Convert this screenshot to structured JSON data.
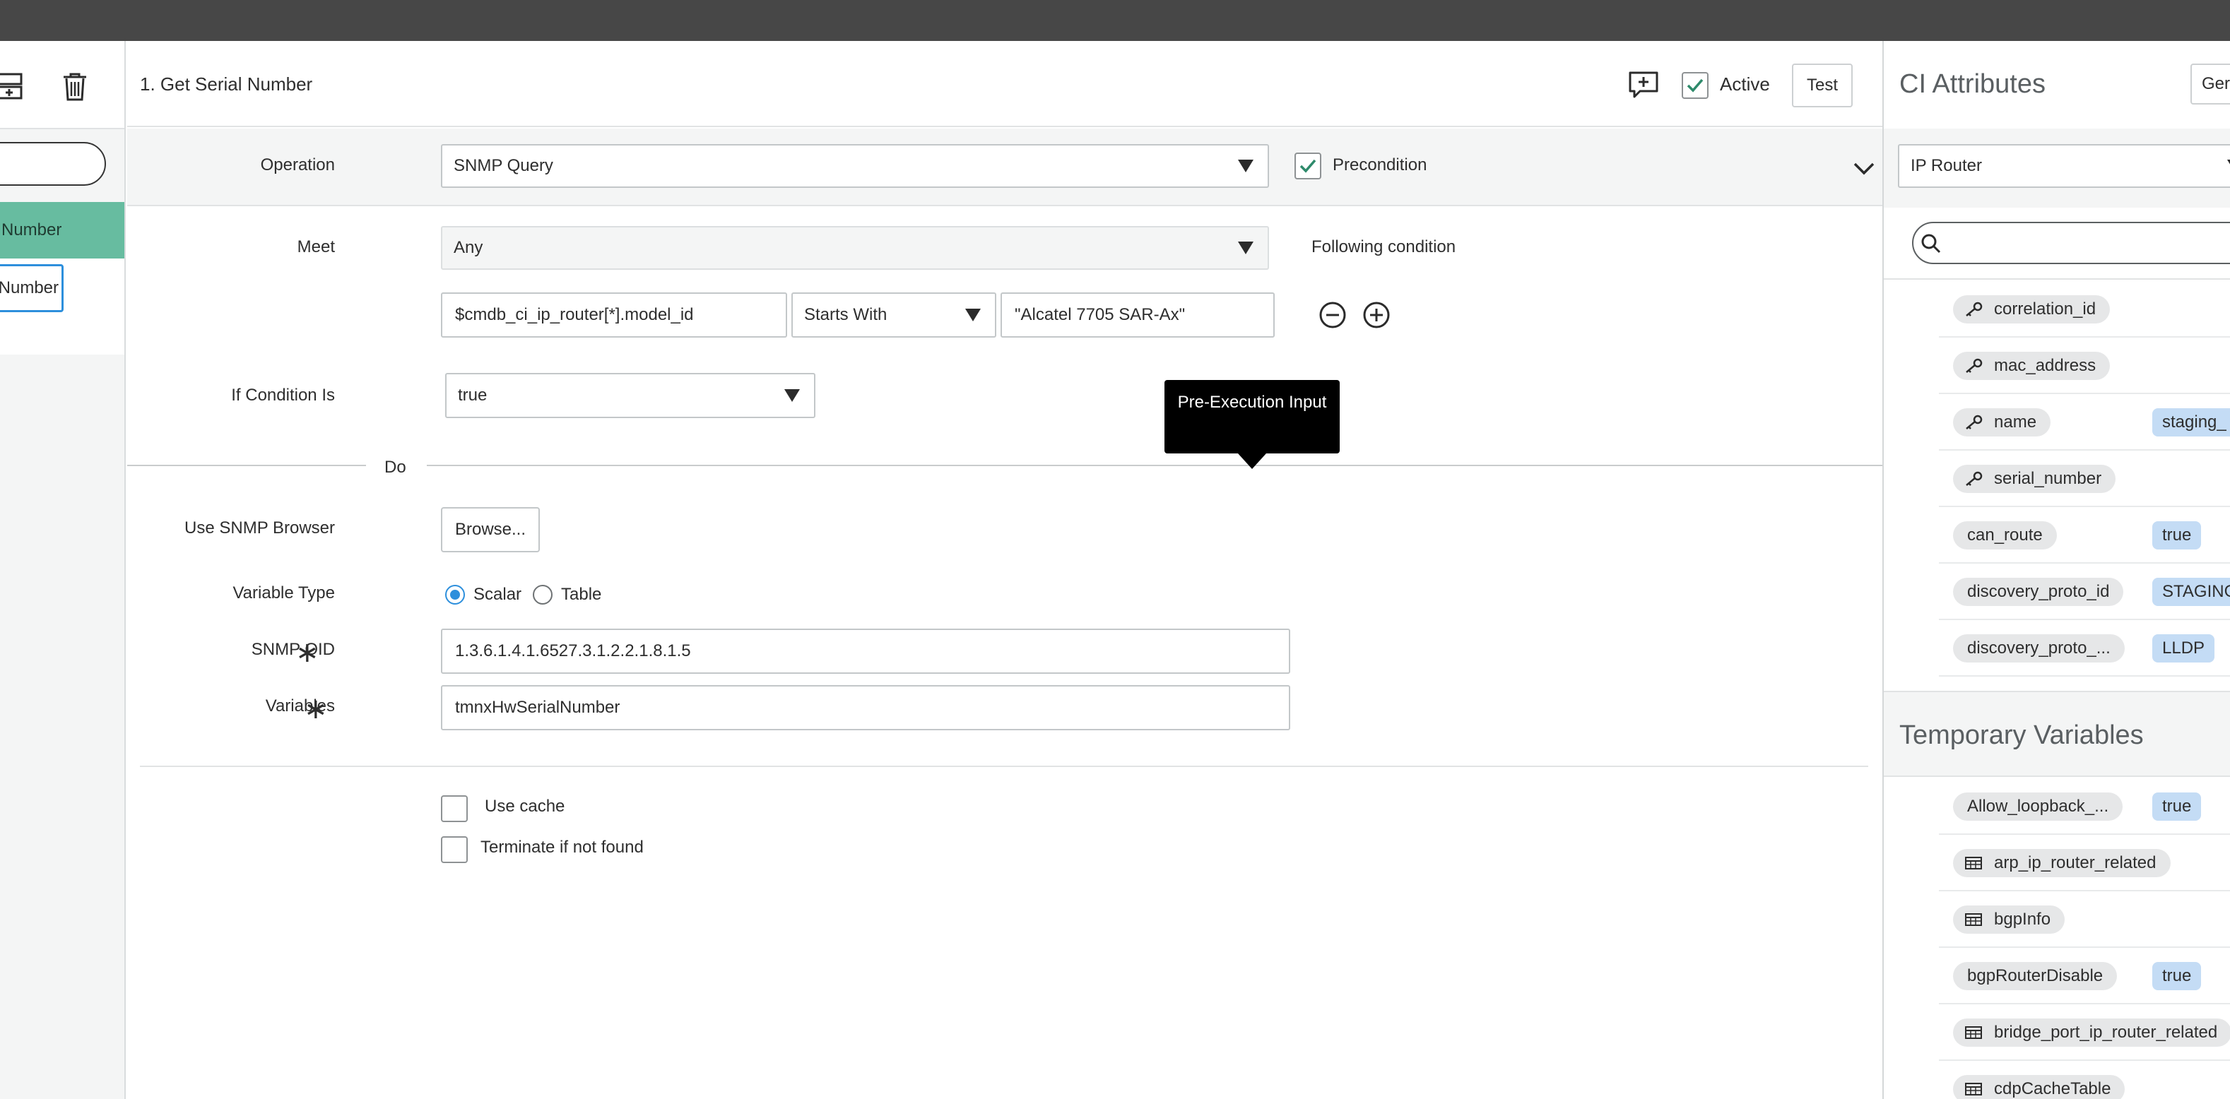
{
  "left_panel": {
    "selected_step": "Number",
    "editing_step": "Number"
  },
  "header": {
    "step_title": "1. Get Serial Number",
    "active_label": "Active",
    "active_checked": true,
    "test_label": "Test"
  },
  "operation": {
    "label": "Operation",
    "value": "SNMP Query",
    "precondition_label": "Precondition",
    "precondition_checked": true
  },
  "condition": {
    "meet_label": "Meet",
    "meet_value": "Any",
    "following_label": "Following condition",
    "field_value": "$cmdb_ci_ip_router[*].model_id",
    "operator_value": "Starts With",
    "match_value": "\"Alcatel 7705 SAR-Ax\"",
    "if_condition_label": "If Condition Is",
    "if_condition_value": "true"
  },
  "do_label": "Do",
  "tooltip": "Pre-Execution Input",
  "snmp": {
    "browser_label": "Use SNMP Browser",
    "browse_button": "Browse...",
    "variable_type_label": "Variable Type",
    "scalar_label": "Scalar",
    "table_label": "Table",
    "selected_type": "Scalar",
    "oid_label": "SNMP OID",
    "oid_value": "1.3.6.1.4.1.6527.3.1.2.2.1.8.1.5",
    "variables_label": "Variables",
    "variables_value": "tmnxHwSerialNumber",
    "use_cache_label": "Use cache",
    "terminate_label": "Terminate if not found"
  },
  "ci_attributes": {
    "title": "CI Attributes",
    "generate_button": "Ger",
    "class_select": "IP Router",
    "search_placeholder": "",
    "items": [
      {
        "name": "correlation_id",
        "key": true,
        "value": ""
      },
      {
        "name": "mac_address",
        "key": true,
        "value": ""
      },
      {
        "name": "name",
        "key": true,
        "value": "staging_"
      },
      {
        "name": "serial_number",
        "key": true,
        "value": ""
      },
      {
        "name": "can_route",
        "key": false,
        "value": "true"
      },
      {
        "name": "discovery_proto_id",
        "key": false,
        "value": "STAGING"
      },
      {
        "name": "discovery_proto_...",
        "key": false,
        "value": "LLDP"
      }
    ]
  },
  "temporary_variables": {
    "title": "Temporary Variables",
    "items": [
      {
        "name": "Allow_loopback_...",
        "table": false,
        "value": "true"
      },
      {
        "name": "arp_ip_router_related",
        "table": true,
        "value": ""
      },
      {
        "name": "bgpInfo",
        "table": true,
        "value": ""
      },
      {
        "name": "bgpRouterDisable",
        "table": false,
        "value": "true"
      },
      {
        "name": "bridge_port_ip_router_related",
        "table": true,
        "value": ""
      },
      {
        "name": "cdpCacheTable",
        "table": true,
        "value": ""
      }
    ]
  },
  "colors": {
    "accent_green": "#67bca0",
    "check_green": "#2e8a6b",
    "focus_blue": "#2d8fdc",
    "value_chip": "#c4dcf5",
    "topbar": "#474747"
  },
  "icons": [
    "add-step-icon",
    "trash-icon",
    "add-comment-icon",
    "check-icon",
    "caret-down-icon",
    "minus-circle-icon",
    "plus-circle-icon",
    "search-icon",
    "key-icon",
    "table-icon",
    "chevron-down-icon"
  ]
}
